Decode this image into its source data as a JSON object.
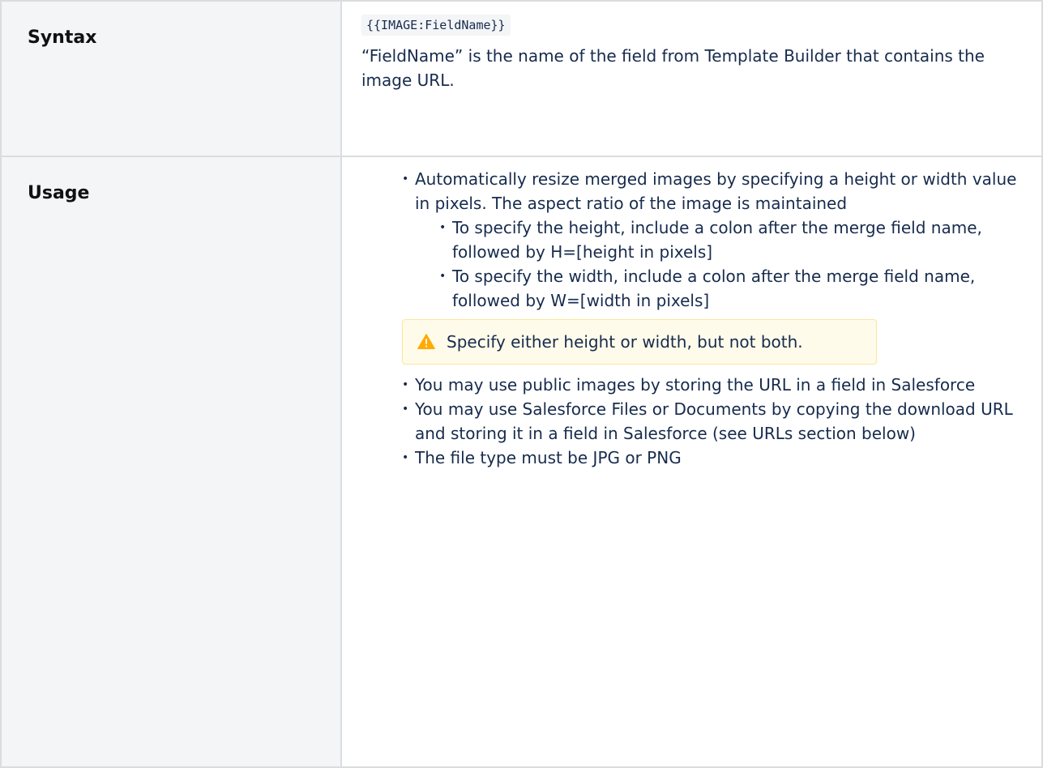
{
  "rows": {
    "syntax": {
      "label": "Syntax",
      "code": "{{IMAGE:FieldName}}",
      "description": "“FieldName” is the name of the field from Template Builder that contains the image URL."
    },
    "usage": {
      "label": "Usage",
      "items": [
        "Automatically resize merged images by specifying a height or width value in pixels. The aspect ratio of the image is maintained"
      ],
      "subitems": [
        "To specify the height, include a colon after the merge field name, followed by H=[height in pixels]",
        "To specify the width, include a colon after the merge field name, followed by W=[width in pixels]"
      ],
      "note": "Specify either height or width, but not both.",
      "more_items": [
        "You may use public images by storing the URL in a field in Salesforce",
        "You may use Salesforce Files or Documents by copying the download URL and storing it in a field in Salesforce (see URLs section below)",
        "The file type must be JPG or PNG"
      ]
    }
  },
  "icons": {
    "note": "warning-icon"
  },
  "colors": {
    "label_bg": "#f4f5f7",
    "border": "#dcdcdc",
    "note_bg": "#fffbea",
    "note_border": "#ffe49c",
    "warning": "#ffab00"
  }
}
